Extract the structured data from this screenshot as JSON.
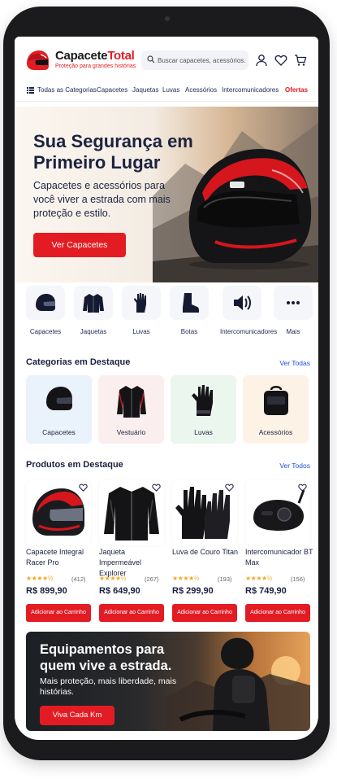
{
  "brand": {
    "name_part1": "Capacete",
    "name_part2": "Total",
    "tagline": "Proteção para grandes histórias",
    "accent_color": "#e31c23"
  },
  "search": {
    "placeholder": "Buscar capacetes, acessórios..."
  },
  "header_icons": [
    "user-icon",
    "heart-icon",
    "cart-icon"
  ],
  "nav": {
    "items": [
      "Todas as Categorias",
      "Capacetes",
      "Jaquetas",
      "Luvas",
      "Acessórios",
      "Intercomunicadores",
      "Ofertas"
    ]
  },
  "hero": {
    "title": "Sua Segurança em Primeiro Lugar",
    "subtitle": "Capacetes e acessórios para você viver a estrada com mais proteção e estilo.",
    "button": "Ver Capacetes"
  },
  "quick_categories": [
    {
      "label": "Capacetes",
      "icon": "helmet-icon"
    },
    {
      "label": "Jaquetas",
      "icon": "jacket-icon"
    },
    {
      "label": "Luvas",
      "icon": "glove-icon"
    },
    {
      "label": "Botas",
      "icon": "boot-icon"
    },
    {
      "label": "Intercomunicadores",
      "icon": "intercom-icon"
    },
    {
      "label": "Mais",
      "icon": "more-icon"
    }
  ],
  "featured_categories": {
    "title": "Categorias em Destaque",
    "link": "Ver Todas",
    "items": [
      {
        "label": "Capacetes",
        "bg": "#eaf2fb"
      },
      {
        "label": "Vestuário",
        "bg": "#fbeeee"
      },
      {
        "label": "Luvas",
        "bg": "#eaf6ee"
      },
      {
        "label": "Acessórios",
        "bg": "#fcf3e6"
      }
    ]
  },
  "featured_products": {
    "title": "Produtos em Destaque",
    "link": "Ver Todos",
    "items": [
      {
        "name": "Capacete Integral Racer Pro",
        "stars": "★★★★½",
        "reviews": "(412)",
        "price": "R$ 899,90",
        "button": "Adicionar ao Carrinho"
      },
      {
        "name": "Jaqueta Impermeável Explorer",
        "stars": "★★★★½",
        "reviews": "(267)",
        "price": "R$ 649,90",
        "button": "Adicionar ao Carrinho"
      },
      {
        "name": "Luva de Couro Titan",
        "stars": "★★★★½",
        "reviews": "(193)",
        "price": "R$ 299,90",
        "button": "Adicionar ao Carrinho"
      },
      {
        "name": "Intercomunicador BT Max",
        "stars": "★★★★½",
        "reviews": "(156)",
        "price": "R$ 749,90",
        "button": "Adicionar ao Carrinho"
      }
    ]
  },
  "promo_banner": {
    "title": "Equipamentos para quem vive a estrada.",
    "subtitle": "Mais proteção, mais liberdade, mais histórias.",
    "button": "Viva Cada Km"
  }
}
